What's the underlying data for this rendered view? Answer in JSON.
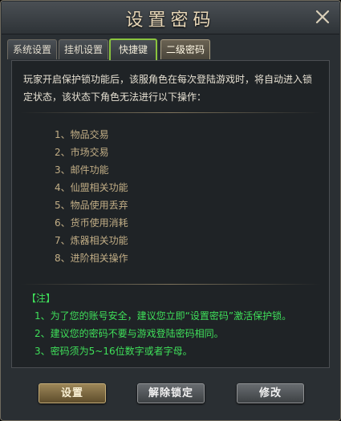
{
  "window": {
    "title": "设置密码",
    "close_icon": "close-icon"
  },
  "tabs": [
    {
      "label": "系统设置",
      "state": "normal"
    },
    {
      "label": "挂机设置",
      "state": "normal"
    },
    {
      "label": "快捷键",
      "state": "highlighted"
    },
    {
      "label": "二级密码",
      "state": "selected"
    }
  ],
  "content": {
    "intro": "玩家开启保护锁功能后，该服角色在每次登陆游戏时，将自动进入锁定状态，该状态下角色无法进行以下操作：",
    "operations": [
      "1、物品交易",
      "2、市场交易",
      "3、邮件功能",
      "4、仙盟相关功能",
      "5、物品使用丢弃",
      "6、货币使用消耗",
      "7、炼器相关功能",
      "8、进阶相关操作"
    ],
    "notes": {
      "title": "【注】",
      "lines": [
        "1、为了您的账号安全，建议您立即“设置密码”激活保护锁。",
        "2、建议您的密码不要与游戏登陆密码相同。",
        "3、密码须为5~16位数字或者字母。"
      ]
    }
  },
  "buttons": {
    "set": "设置",
    "unlock": "解除锁定",
    "modify": "修改"
  },
  "colors": {
    "note_green": "#3fe05a",
    "operation_text": "#c2ae86",
    "tab_highlight": "#8ac43e"
  }
}
